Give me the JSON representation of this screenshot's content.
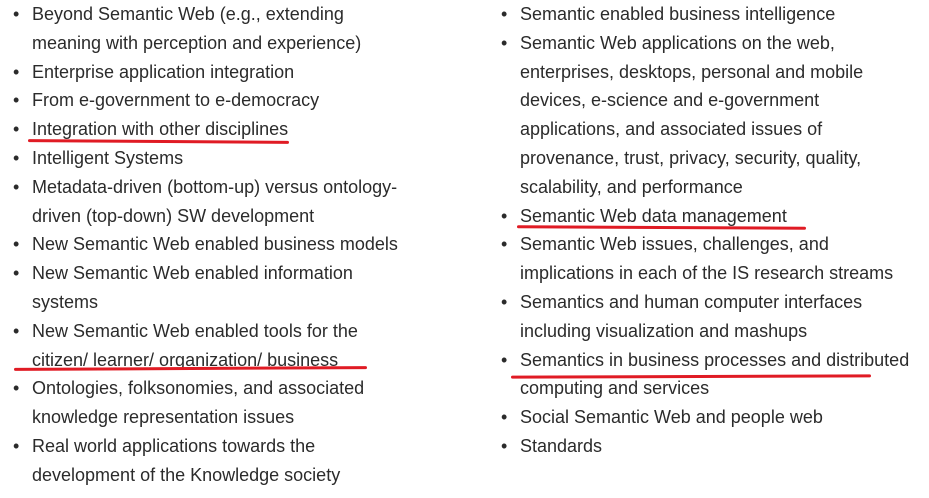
{
  "left_column": {
    "items": [
      "Beyond Semantic Web (e.g., extending meaning with perception and experience)",
      "Enterprise application integration",
      "From e-government to e-democracy",
      "Integration with other disciplines",
      "Intelligent Systems",
      "Metadata-driven (bottom-up) versus ontology-driven (top-down) SW development",
      "New Semantic Web enabled business models",
      "New Semantic Web enabled information systems",
      "New Semantic Web enabled tools for the citizen/ learner/ organization/ business",
      "Ontologies, folksonomies, and associated knowledge representation issues",
      "Real world applications towards the development of the Knowledge society"
    ]
  },
  "right_column": {
    "items": [
      "Semantic enabled business intelligence",
      "Semantic Web applications on the web, enterprises, desktops, personal and mobile devices, e-science and e-government applications, and associated issues of provenance, trust, privacy, security, quality, scalability, and performance",
      "Semantic Web data management",
      "Semantic Web issues, challenges, and implications in each of the IS research streams",
      "Semantics and human computer interfaces including visualization and mashups",
      "Semantics in business processes and distributed computing and services",
      "Social Semantic Web and people web",
      "Standards"
    ]
  },
  "colors": {
    "text": "#2b2b2b",
    "underline": "#e01b24",
    "background": "#ffffff"
  }
}
